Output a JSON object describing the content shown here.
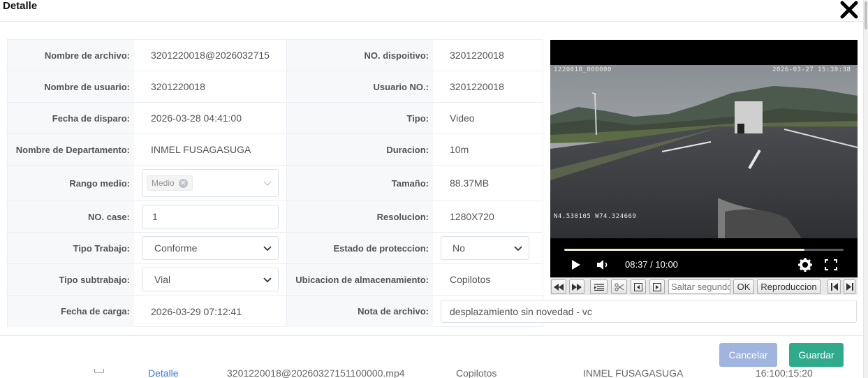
{
  "dialog": {
    "title": "Detalle"
  },
  "fields": {
    "nombre_archivo": {
      "label": "Nombre de archivo:",
      "value": "3201220018@2026032715"
    },
    "no_dispositivo": {
      "label": "NO. dispoitivo:",
      "value": "3201220018"
    },
    "nombre_usuario": {
      "label": "Nombre de usuario:",
      "value": "3201220018"
    },
    "usuario_no": {
      "label": "Usuario NO.:",
      "value": "3201220018"
    },
    "fecha_disparo": {
      "label": "Fecha de disparo:",
      "value": "2026-03-28 04:41:00"
    },
    "tipo": {
      "label": "Tipo:",
      "value": "Video"
    },
    "departamento": {
      "label": "Nombre de Departamento:",
      "value": "INMEL FUSAGASUGA"
    },
    "duracion": {
      "label": "Duracion:",
      "value": "10m"
    },
    "rango_medio": {
      "label": "Rango medio:",
      "tag": "Medio"
    },
    "tamano": {
      "label": "Tamaño:",
      "value": "88.37MB"
    },
    "no_case": {
      "label": "NO. case:",
      "value": "1"
    },
    "resolucion": {
      "label": "Resolucion:",
      "value": "1280X720"
    },
    "tipo_trabajo": {
      "label": "Tipo Trabajo:",
      "value": "Conforme"
    },
    "estado_proteccion": {
      "label": "Estado de proteccion:",
      "value": "No"
    },
    "tipo_subtrabajo": {
      "label": "Tipo subtrabajo:",
      "value": "Vial"
    },
    "ubicacion": {
      "label": "Ubicacion de almacenamiento:",
      "value": "Copilotos"
    },
    "fecha_carga": {
      "label": "Fecha de carga:",
      "value": "2026-03-29 07:12:41"
    },
    "nota": {
      "label": "Nota de archivo:",
      "value": "desplazamiento sin novedad - vc"
    }
  },
  "video": {
    "osd_channel": "1220018_000000",
    "osd_datetime": "2026-03-27 15:39:38",
    "osd_gps": "N4.530105  W74.324669",
    "time_display": "08:37 / 10:00",
    "progress": 0.86
  },
  "toolbar": {
    "seek_placeholder": "Saltar segundos",
    "ok_label": "OK",
    "playback_label": "Reproduccion"
  },
  "footer": {
    "cancel_label": "Cancelar",
    "save_label": "Guardar"
  },
  "background_row": {
    "link": "Detalle",
    "file": "3201220018@20260327151100000.mp4",
    "location": "Copilotos",
    "dept": "INMEL FUSAGASUGA",
    "time": "16:100:15:20"
  },
  "colors": {
    "save": "#2fab8c",
    "cancel": "#a0b4e0"
  }
}
